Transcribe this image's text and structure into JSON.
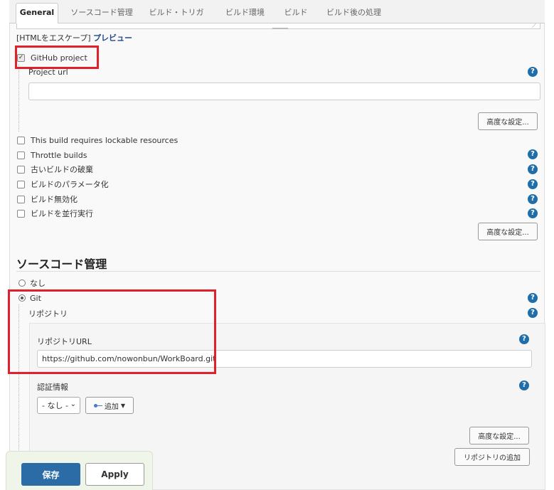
{
  "tabs": [
    "General",
    "ソースコード管理",
    "ビルド・トリガ",
    "ビルド環境",
    "ビルド",
    "ビルド後の処理"
  ],
  "escape_line": {
    "prefix": "[HTMLをエスケープ]",
    "preview_link": "プレビュー"
  },
  "github": {
    "checkbox_label": "GitHub project",
    "checked": true,
    "project_url_label": "Project url",
    "project_url_value": "",
    "advanced_label": "高度な設定..."
  },
  "options": [
    {
      "label": "This build requires lockable resources",
      "checked": false,
      "help": false
    },
    {
      "label": "Throttle builds",
      "checked": false,
      "help": true
    },
    {
      "label": "古いビルドの破棄",
      "checked": false,
      "help": true
    },
    {
      "label": "ビルドのパラメータ化",
      "checked": false,
      "help": true
    },
    {
      "label": "ビルド無効化",
      "checked": false,
      "help": true
    },
    {
      "label": "ビルドを並行実行",
      "checked": false,
      "help": true
    }
  ],
  "options_advanced_label": "高度な設定...",
  "scm": {
    "section_title": "ソースコード管理",
    "none_label": "なし",
    "git_label": "Git",
    "selected": "Git",
    "repositories_label": "リポジトリ",
    "repo_url_label": "リポジトリURL",
    "repo_url_value": "https://github.com/nowonbun/WorkBoard.git",
    "credentials_label": "認証情報",
    "credentials_selected": "- なし -",
    "add_label": "追加",
    "advanced_label": "高度な設定...",
    "add_repo_label": "リポジトリの追加"
  },
  "help_glyph": "?",
  "footer": {
    "save_label": "保存",
    "apply_label": "Apply"
  },
  "colors": {
    "accent": "#2b6ca7",
    "help": "#1f6ea9",
    "highlight": "#e0202a"
  }
}
